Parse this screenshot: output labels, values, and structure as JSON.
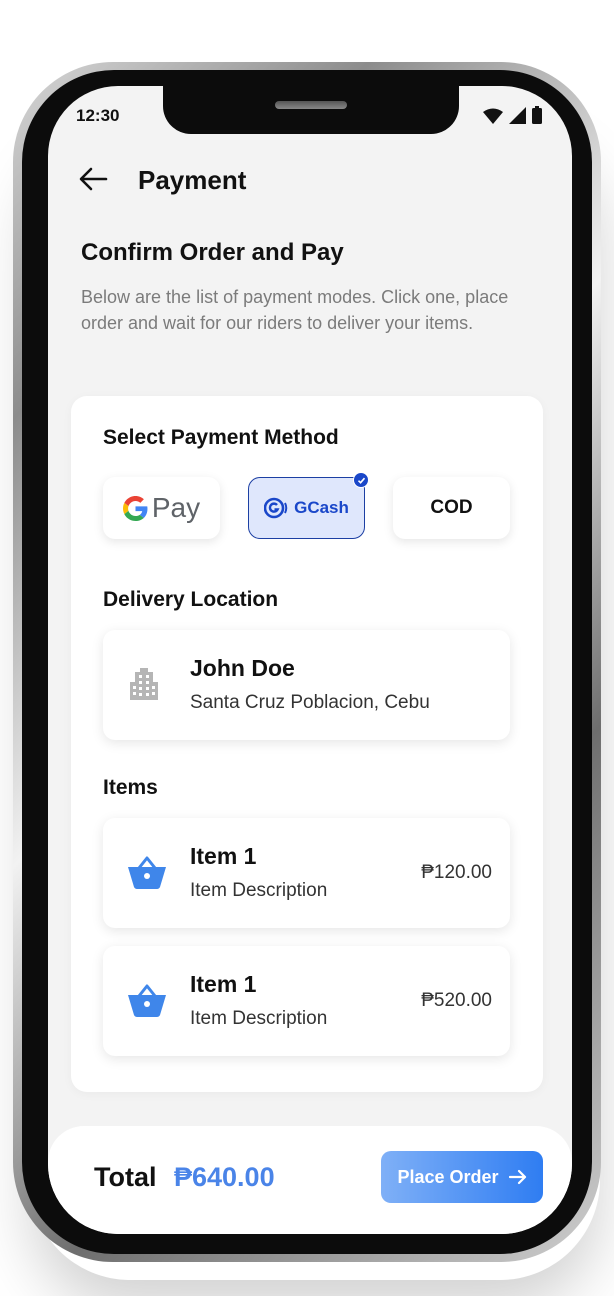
{
  "status_bar": {
    "time": "12:30"
  },
  "header": {
    "title": "Payment"
  },
  "confirm": {
    "heading": "Confirm Order and Pay",
    "description": "Below are the list of payment modes. Click one, place order and wait for our riders to deliver your items."
  },
  "payment_method": {
    "label": "Select Payment Method",
    "options": [
      {
        "label": "Pay",
        "icon": "google-g-icon",
        "selected": false
      },
      {
        "label": "GCash",
        "icon": "gcash-icon",
        "selected": true
      },
      {
        "label": "COD",
        "selected": false
      }
    ]
  },
  "delivery": {
    "label": "Delivery Location",
    "name": "John Doe",
    "address": "Santa Cruz Poblacion, Cebu",
    "icon": "building-icon"
  },
  "items": {
    "label": "Items",
    "list": [
      {
        "name": "Item 1",
        "description": "Item Description",
        "price": "₱120.00",
        "icon": "basket-icon"
      },
      {
        "name": "Item 1",
        "description": "Item Description",
        "price": "₱520.00",
        "icon": "basket-icon"
      }
    ]
  },
  "footer": {
    "total_label": "Total",
    "total_value": "₱640.00",
    "place_order_label": "Place Order"
  },
  "colors": {
    "accent": "#4a84e8",
    "gcash_blue": "#1a47c9",
    "selected_bg": "#dfe7fc",
    "screen_bg": "#f3f3f3"
  }
}
